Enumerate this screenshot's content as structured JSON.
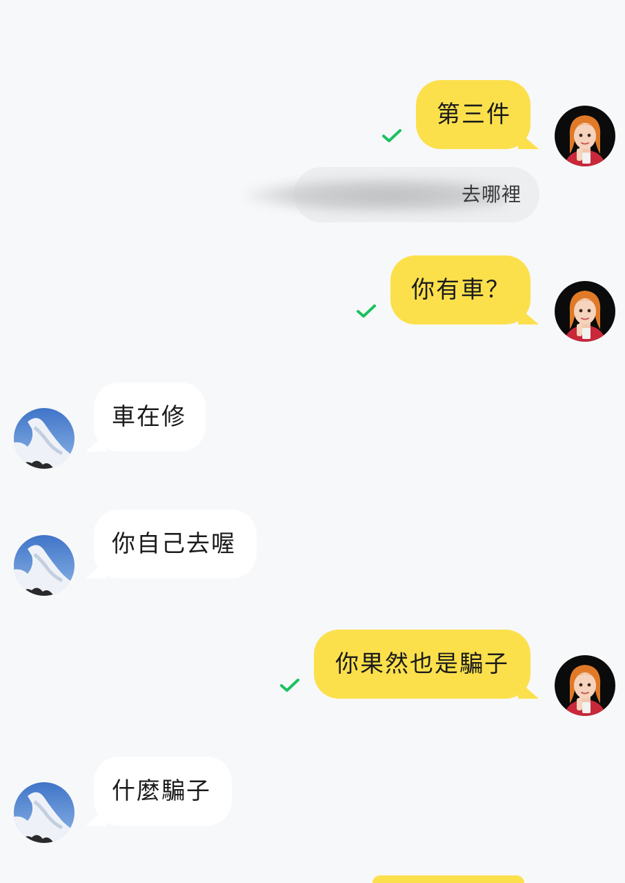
{
  "colors": {
    "background": "#f7f8f9",
    "my_bubble": "#fbe04c",
    "their_bubble": "#ffffff",
    "read_check": "#19c15e",
    "reply_bubble": "#eceef0"
  },
  "messages": [
    {
      "side": "me",
      "text": "第三件",
      "status_icon": "check-icon"
    },
    {
      "side": "me",
      "reply_preview": "去哪裡",
      "reply_sender_blurred": true
    },
    {
      "side": "me",
      "text": "你有車？",
      "status_icon": "check-icon"
    },
    {
      "side": "them",
      "text": "車在修"
    },
    {
      "side": "them",
      "text": "你自己去喔"
    },
    {
      "side": "me",
      "text": "你果然也是騙子",
      "status_icon": "check-icon"
    },
    {
      "side": "them",
      "text": "什麼騙子"
    }
  ],
  "avatars": {
    "me": "cartoon-girl-avatar-icon",
    "them": "cloud-sky-avatar-icon"
  }
}
